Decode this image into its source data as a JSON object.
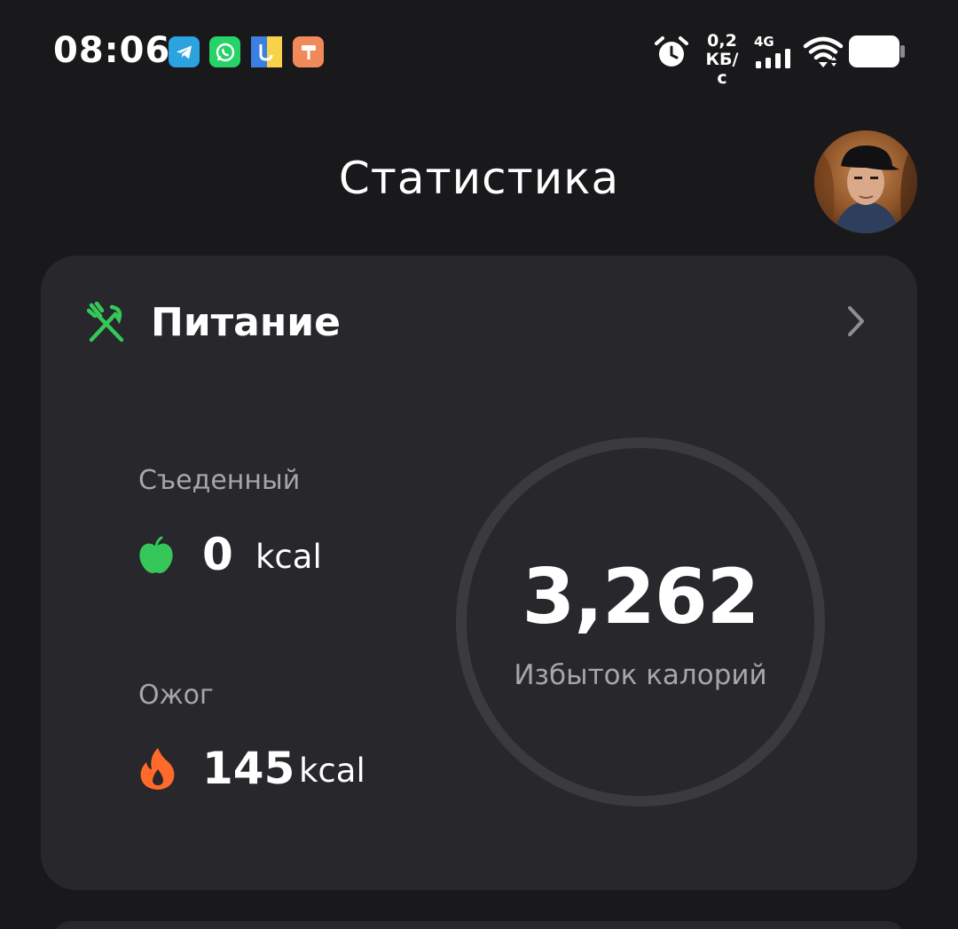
{
  "status_bar": {
    "time": "08:06",
    "notifications": [
      {
        "icon": "telegram-icon",
        "color": "#2aa3df"
      },
      {
        "icon": "whatsapp-icon",
        "color": "#25d366"
      },
      {
        "icon": "bank-app-icon",
        "color": "#3b7fe0"
      },
      {
        "icon": "paint-roller-app-icon",
        "color": "#f08a5a"
      }
    ],
    "alarm_icon": "alarm-clock-icon",
    "net_speed_value": "0,2",
    "net_speed_unit": "КБ/с",
    "network_type": "4G",
    "signal_icon": "cellular-signal-icon",
    "wifi_icon": "wifi-icon",
    "battery_icon": "battery-icon"
  },
  "header": {
    "title": "Статистика",
    "avatar_icon": "user-avatar"
  },
  "nutrition_card": {
    "title": "Питание",
    "title_icon": "fork-knife-icon",
    "accent_color": "#35c759",
    "eaten": {
      "label": "Съеденный",
      "value": "0",
      "unit": "kcal",
      "icon": "apple-icon",
      "icon_color": "#35c759"
    },
    "burned": {
      "label": "Ожог",
      "value": "145",
      "unit": "kcal",
      "icon": "flame-icon",
      "icon_color": "#ff6a2a"
    },
    "summary": {
      "value": "3,262",
      "label": "Избыток калорий"
    },
    "chevron_icon": "chevron-right-icon"
  }
}
